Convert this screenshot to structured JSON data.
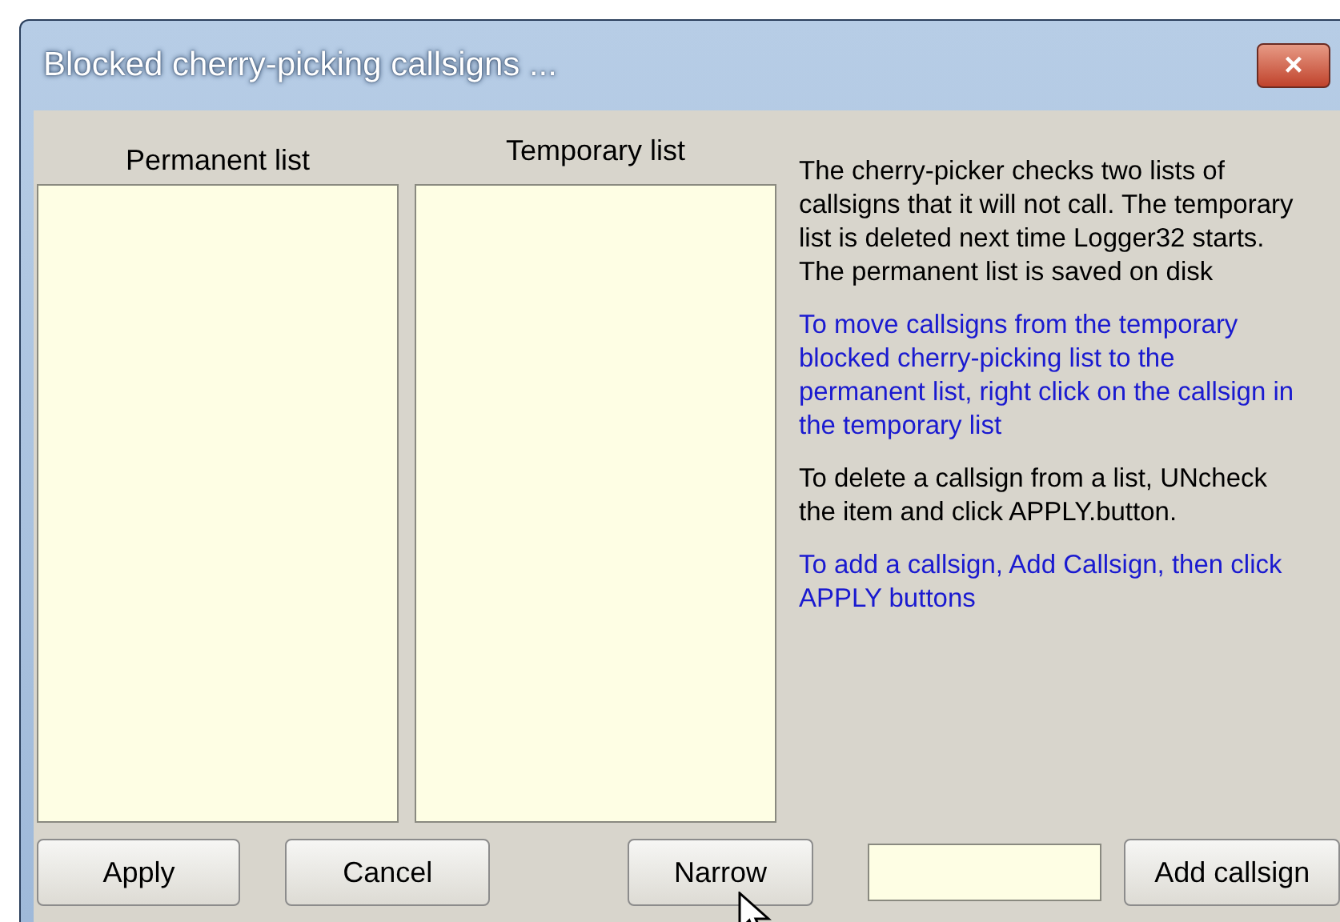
{
  "window": {
    "title": "Blocked cherry-picking callsigns ...",
    "close": "×"
  },
  "lists": [
    {
      "label": "Permanent list"
    },
    {
      "label": "Temporary list"
    }
  ],
  "notes": [
    {
      "text": "The cherry-picker checks two lists of callsigns that it will not call. The temporary list is deleted next time Logger32 starts.  The permanent list is saved on disk",
      "color": "#000000"
    },
    {
      "text": "To move callsigns from the temporary blocked cherry-picking list to the permanent list, right click on the callsign in the temporary list",
      "color": "#1a1ad0"
    },
    {
      "text": "To delete a callsign from a list, UNcheck the item and click APPLY.button.",
      "color": "#000000"
    },
    {
      "text": "To add a callsign, Add Callsign, then click APPLY buttons",
      "color": "#1a1ad0"
    }
  ],
  "buttons": [
    {
      "label": "Apply",
      "kind": "button"
    },
    {
      "label": "Cancel",
      "kind": "button"
    },
    {
      "label": "Narrow",
      "kind": "button"
    },
    {
      "kind": "field"
    },
    {
      "label": "Add callsign",
      "kind": "button"
    }
  ]
}
